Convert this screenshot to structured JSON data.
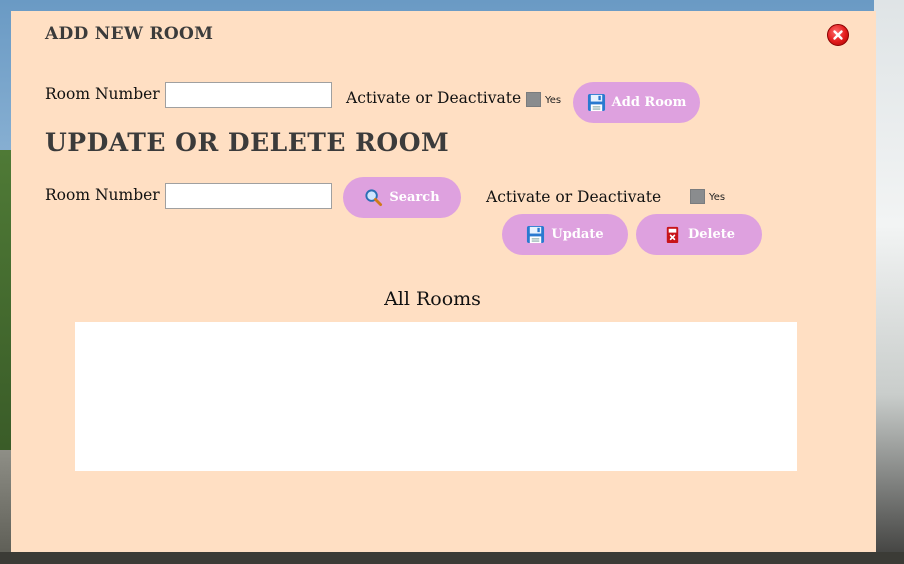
{
  "add_section": {
    "title": "ADD NEW ROOM",
    "room_number_label": "Room Number",
    "room_number_value": "",
    "activate_label": "Activate or Deactivate",
    "checkbox_label": "Yes",
    "add_button_label": "Add Room"
  },
  "update_section": {
    "title": "UPDATE OR DELETE ROOM",
    "room_number_label": "Room Number",
    "room_number_value": "",
    "search_button_label": "Search",
    "activate_label": "Activate or Deactivate",
    "checkbox_label": "Yes",
    "update_button_label": "Update",
    "delete_button_label": "Delete"
  },
  "table": {
    "title": "All Rooms"
  },
  "icons": {
    "close": "close-icon",
    "save": "floppy-disk-icon",
    "search": "magnifier-icon",
    "delete": "delete-icon"
  },
  "colors": {
    "modal_bg": "#ffdfc3",
    "button_bg": "#dea1df",
    "close_red": "#e21b1b"
  }
}
